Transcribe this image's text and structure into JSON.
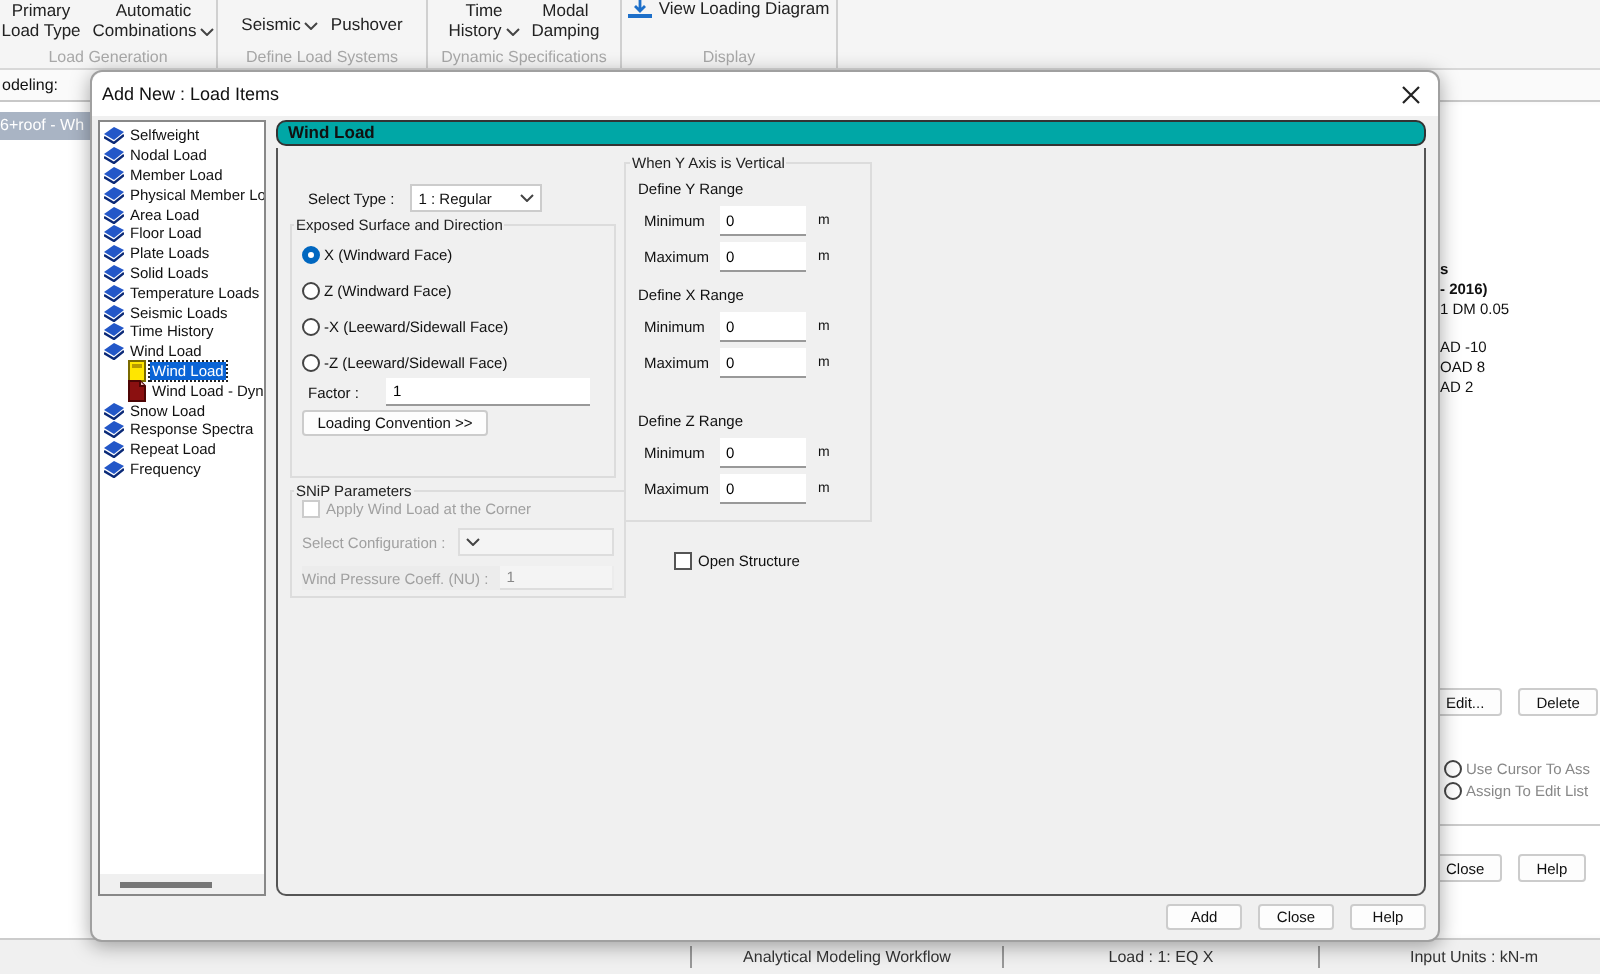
{
  "ribbon": {
    "groups": [
      {
        "label": "Load Generation",
        "items": [
          {
            "kind": "text",
            "lines": [
              "Primary",
              "Load Type"
            ],
            "has_menu": false
          },
          {
            "kind": "text",
            "lines": [
              "Automatic",
              "Combinations"
            ],
            "has_menu": true
          }
        ]
      },
      {
        "label": "Define Load Systems",
        "items": [
          {
            "kind": "text",
            "lines": [
              "Seismic"
            ],
            "has_menu": true
          },
          {
            "kind": "text",
            "lines": [
              "Pushover"
            ],
            "has_menu": false
          }
        ]
      },
      {
        "label": "Dynamic Specifications",
        "items": [
          {
            "kind": "text",
            "lines": [
              "Time",
              "History"
            ],
            "has_menu": true
          },
          {
            "kind": "text",
            "lines": [
              "Modal",
              "Damping"
            ],
            "has_menu": false
          }
        ]
      },
      {
        "label": "Display",
        "items": [
          {
            "kind": "icon",
            "lines": [
              "View Loading Diagram"
            ],
            "has_menu": false
          }
        ]
      }
    ]
  },
  "model_label": "odeling:",
  "document_tab": "6+roof - Wh",
  "side_panel": {
    "lines": [
      {
        "text": "s",
        "bold": true
      },
      {
        "text": "- 2016)",
        "bold": true
      },
      {
        "text": "1 DM 0.05",
        "bold": false
      },
      {
        "text": "AD -10",
        "bold": false
      },
      {
        "text": "OAD 8",
        "bold": false
      },
      {
        "text": "AD 2",
        "bold": false
      }
    ],
    "buttons": [
      "Edit...",
      "Delete"
    ],
    "radios": [
      {
        "label": "Use Cursor To Ass",
        "selected": false
      },
      {
        "label": "Assign To Edit List",
        "selected": false
      }
    ],
    "footer_buttons": [
      "Close",
      "Help"
    ]
  },
  "status_bar": [
    "Analytical Modeling Workflow",
    "Load : 1: EQ X",
    "Input Units : kN-m"
  ],
  "dialog": {
    "title": "Add New : Load Items",
    "tree": [
      {
        "label": "Selfweight",
        "kind": "book",
        "selected": false
      },
      {
        "label": "Nodal Load",
        "kind": "book",
        "selected": false
      },
      {
        "label": "Member Load",
        "kind": "book",
        "selected": false
      },
      {
        "label": "Physical Member Lo",
        "kind": "book",
        "selected": false
      },
      {
        "label": "Area Load",
        "kind": "book",
        "selected": false
      },
      {
        "label": "Floor Load",
        "kind": "book",
        "selected": false
      },
      {
        "label": "Plate Loads",
        "kind": "book",
        "selected": false
      },
      {
        "label": "Solid Loads",
        "kind": "book",
        "selected": false
      },
      {
        "label": "Temperature Loads",
        "kind": "book",
        "selected": false
      },
      {
        "label": "Seismic Loads",
        "kind": "book",
        "selected": false
      },
      {
        "label": "Time History",
        "kind": "book",
        "selected": false
      },
      {
        "label": "Wind Load",
        "kind": "book",
        "selected": false,
        "children": [
          {
            "label": "Wind Load",
            "kind": "note",
            "selected": true
          },
          {
            "label": "Wind Load - Dyn",
            "kind": "sheet",
            "selected": false
          }
        ]
      },
      {
        "label": "Snow Load",
        "kind": "book",
        "selected": false
      },
      {
        "label": "Response Spectra",
        "kind": "book",
        "selected": false
      },
      {
        "label": "Repeat Load",
        "kind": "book",
        "selected": false
      },
      {
        "label": "Frequency",
        "kind": "book",
        "selected": false
      }
    ],
    "panel_title": "Wind Load",
    "select_type": {
      "label": "Select Type :",
      "value": "1 : Regular"
    },
    "exposed": {
      "title": "Exposed Surface and Direction",
      "radios": [
        {
          "label": "X (Windward Face)",
          "selected": true
        },
        {
          "label": "Z (Windward Face)",
          "selected": false
        },
        {
          "label": "-X (Leeward/Sidewall Face)",
          "selected": false
        },
        {
          "label": "-Z (Leeward/Sidewall Face)",
          "selected": false
        }
      ],
      "factor": {
        "label": "Factor :",
        "value": "1"
      },
      "button": "Loading Convention >>"
    },
    "snip": {
      "title": "SNiP Parameters",
      "corner": {
        "label": "Apply Wind Load at the Corner",
        "checked": false,
        "disabled": true
      },
      "configuration": {
        "label": "Select Configuration :",
        "disabled": true
      },
      "coefficient": {
        "label": "Wind Pressure Coeff. (NU) :",
        "value": "1",
        "disabled": true
      }
    },
    "range": {
      "title": "When Y Axis is Vertical",
      "sections": [
        {
          "title": "Define Y Range",
          "fields": [
            {
              "label": "Minimum",
              "value": "0",
              "unit": "m"
            },
            {
              "label": "Maximum",
              "value": "0",
              "unit": "m"
            }
          ]
        },
        {
          "title": "Define X Range",
          "fields": [
            {
              "label": "Minimum",
              "value": "0",
              "unit": "m"
            },
            {
              "label": "Maximum",
              "value": "0",
              "unit": "m"
            }
          ]
        },
        {
          "title": "Define Z Range",
          "fields": [
            {
              "label": "Minimum",
              "value": "0",
              "unit": "m"
            },
            {
              "label": "Maximum",
              "value": "0",
              "unit": "m"
            }
          ]
        }
      ]
    },
    "open_structure": {
      "label": "Open Structure",
      "checked": false
    },
    "buttons": [
      "Add",
      "Close",
      "Help"
    ]
  }
}
